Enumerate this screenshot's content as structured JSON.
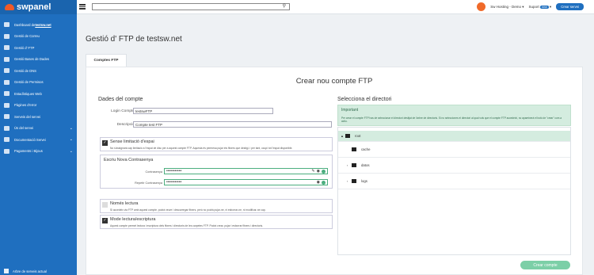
{
  "brand": {
    "name": "swpanel"
  },
  "sidebar": {
    "items": [
      {
        "prefix": "Dashboard de ",
        "bold": "testsw.net",
        "chevron": false
      },
      {
        "prefix": "Gestió de Correu",
        "bold": "",
        "chevron": false
      },
      {
        "prefix": "Gestió d' FTP",
        "bold": "",
        "chevron": false
      },
      {
        "prefix": "Gestió Bases de Dades",
        "bold": "",
        "chevron": false
      },
      {
        "prefix": "Gestió de DNS",
        "bold": "",
        "chevron": false
      },
      {
        "prefix": "Gestió de Permisos",
        "bold": "",
        "chevron": false
      },
      {
        "prefix": "Estadístiques Web",
        "bold": "",
        "chevron": false
      },
      {
        "prefix": "Pàgines d'error",
        "bold": "",
        "chevron": false
      },
      {
        "prefix": "Serveis del servei",
        "bold": "",
        "chevron": false
      },
      {
        "prefix": "Ús del servei",
        "bold": "",
        "chevron": true
      },
      {
        "prefix": "Documentació Servei",
        "bold": "",
        "chevron": true
      },
      {
        "prefix": "Pagaments i Bijous",
        "bold": "",
        "chevron": true
      }
    ],
    "footer": "Arbre de serveis actual"
  },
  "topbar": {
    "account": "Sw Hosting - Demo",
    "support": "Suport",
    "support_badge": "new",
    "create_button": "Crear servei"
  },
  "page": {
    "title": "Gestió d' FTP de testsw.net",
    "tab": "Comptes FTP",
    "card_title": "Crear nou compte FTP"
  },
  "account": {
    "heading": "Dades del compte",
    "login_label": "Login Compte",
    "login_value": "testswFTP",
    "desc_label": "Descripció",
    "desc_value": "Compte test FTP"
  },
  "options": {
    "space": {
      "title": "Sense limitació d'espai",
      "desc": "No s'assignarà cap limitació a l'espai de disc per a aquest compte FTP. Aquesta és permesa pujar els fitxers que desitgi, i per tant, ocupi tot l'espai disponible."
    },
    "password": {
      "title": "Escriu Nova Contrasenya",
      "pw_label": "Contrasenya",
      "pw_value": "•••••••••••",
      "repeat_label": "Repetir Contrasenya",
      "repeat_value": "•••••••••••"
    },
    "readonly": {
      "title": "Només lectura",
      "desc": "Si accedeix via FTP amb aquest compte, podrà veure i descarregar fitxers, però no podrà pujar-ne, ni esborrar-ne, ni modificar-ne cap."
    },
    "readwrite": {
      "title": "Mode lectura/escriptura",
      "desc": "Aquest compte permet lectura i escriptura dels fitxers i directoris de les carpetes FTP. Podrà crear, pujar i esborrar fitxers i directoris."
    }
  },
  "directory": {
    "heading": "Selecciona el directori",
    "important_title": "Important",
    "important_desc": "Per crear el compte FTP has de seleccionar el directori desitjat de l'arbre de directoris. Si no selecciones el directori al qual vols que el compte FTP accedeixi, no apareixerà el botó de \"crear\" com a actiu.",
    "tree": [
      {
        "name": "root",
        "level": 0,
        "toggle": "▲",
        "selected": true
      },
      {
        "name": "cache",
        "level": 1,
        "toggle": "",
        "selected": false
      },
      {
        "name": "datos",
        "level": 1,
        "toggle": "›",
        "selected": false
      },
      {
        "name": "logs",
        "level": 1,
        "toggle": "›",
        "selected": false
      }
    ],
    "create_button": "Crear compte"
  }
}
